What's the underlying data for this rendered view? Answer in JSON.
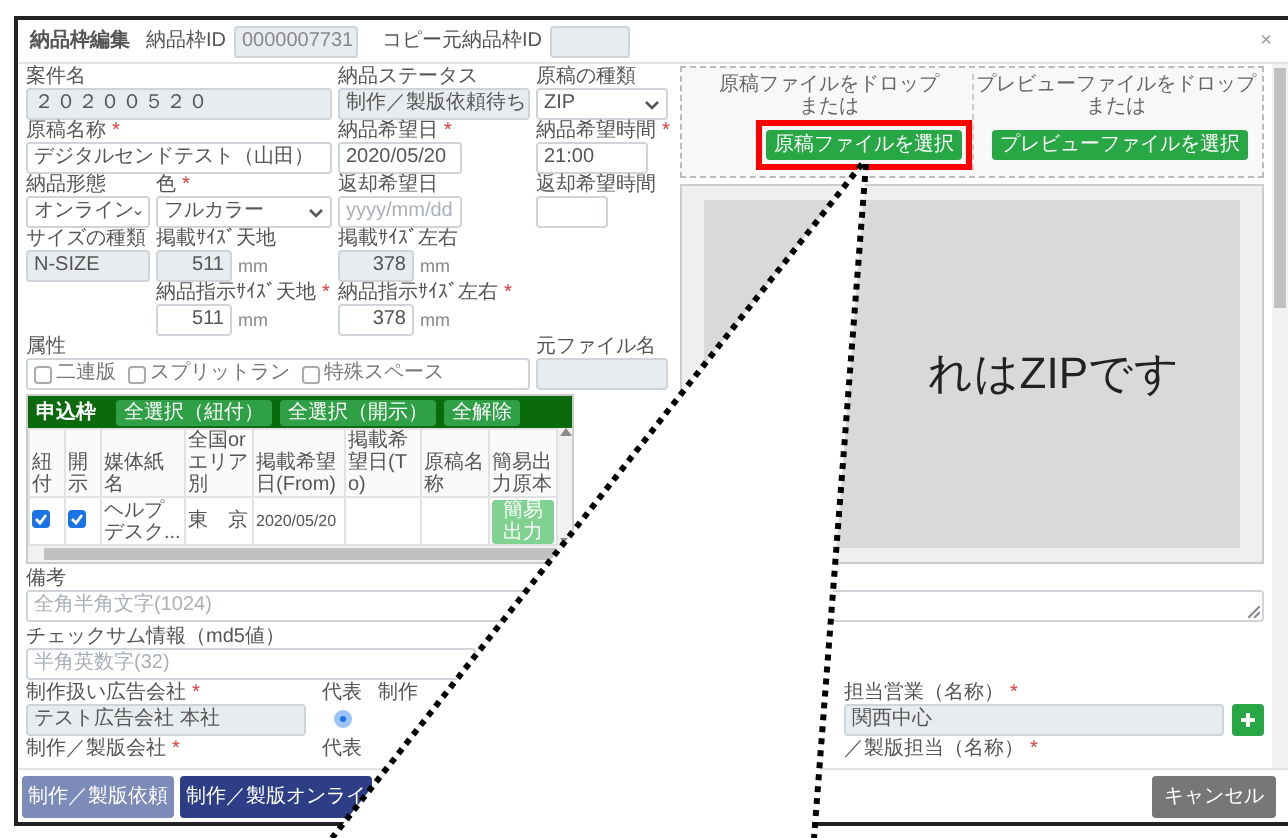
{
  "modal": {
    "title": "納品枠編集",
    "id_label": "納品枠ID",
    "id_value": "0000007731",
    "copy_label": "コピー元納品枠ID",
    "close": "×"
  },
  "form_rows": [
    [
      {
        "kind": "text",
        "label": "案件名",
        "value": "２０２００５２０",
        "readonly": true
      },
      {
        "kind": "text",
        "label": "納品ステータス",
        "value": "制作／製版依頼待ち",
        "readonly": true
      },
      {
        "kind": "select",
        "label": "原稿の種類",
        "value": "ZIP"
      }
    ],
    [
      {
        "kind": "text",
        "label": "原稿名称",
        "required_mark": "*",
        "value": "デジタルセンドテスト（山田）",
        "readonly": false
      },
      {
        "kind": "text",
        "label": "納品希望日",
        "required_mark": "*",
        "value": "2020/05/20",
        "readonly": false
      },
      {
        "kind": "text",
        "label": "納品希望時間",
        "required_mark": "*",
        "value": "21:00",
        "readonly": false
      }
    ],
    [
      {
        "kind": "select",
        "label": "納品形態",
        "value": "オンライン"
      },
      {
        "kind": "select",
        "label": "色",
        "required_mark": "*",
        "value": "フルカラー"
      },
      {
        "kind": "text",
        "label": "返却希望日",
        "placeholder": "yyyy/mm/dd",
        "readonly": false
      },
      {
        "kind": "text",
        "label": "返却希望時間",
        "readonly": false
      }
    ],
    [
      {
        "kind": "text",
        "label": "サイズの種類",
        "value": "N-SIZE",
        "readonly": true
      },
      {
        "kind": "unit",
        "label": "掲載ｻｲｽﾞ天地",
        "value": "511",
        "unit": "mm",
        "readonly": true
      },
      {
        "kind": "unit",
        "label": "掲載ｻｲｽﾞ左右",
        "value": "378",
        "unit": "mm",
        "readonly": true
      }
    ],
    [
      {
        "kind": "unit",
        "label": "納品指示ｻｲｽﾞ天地",
        "required_mark": "*",
        "value": "511",
        "unit": "mm",
        "readonly": false
      },
      {
        "kind": "unit",
        "label": "納品指示ｻｲｽﾞ左右",
        "required_mark": "*",
        "value": "378",
        "unit": "mm",
        "readonly": false
      }
    ],
    [
      {
        "kind": "checks",
        "label": "属性",
        "options": [
          {
            "label": "二連版",
            "checked": false
          },
          {
            "label": "スプリットラン",
            "checked": false
          },
          {
            "label": "特殊スペース",
            "checked": false
          }
        ]
      },
      {
        "kind": "text",
        "label": "元ファイル名",
        "readonly": true
      }
    ]
  ],
  "applications": {
    "title": "申込枠",
    "buttons": [
      "全選択（紐付）",
      "全選択（開示）",
      "全解除"
    ],
    "columns": [
      "紐付",
      "開示",
      "媒体紙名",
      "全国or エリア別",
      "掲載希望日(From)",
      "掲載希望日(To)",
      "原稿名称",
      "簡易出力原本"
    ],
    "rows": [
      {
        "cells": [
          {
            "kind": "check",
            "checked": true
          },
          {
            "kind": "check",
            "checked": true
          },
          {
            "kind": "text",
            "text": "ヘルプデスク..."
          },
          {
            "kind": "text",
            "text": "東　京"
          },
          {
            "kind": "date",
            "text": "2020/05/20"
          },
          {
            "kind": "empty"
          },
          {
            "kind": "empty"
          },
          {
            "kind": "button",
            "text": "簡易出力"
          }
        ]
      }
    ]
  },
  "uploads": [
    {
      "drop_text": "原稿ファイルをドロップ",
      "or_text": "または",
      "button": "原稿ファイルを選択",
      "highlighted": true
    },
    {
      "drop_text": "プレビューファイルをドロップ",
      "or_text": "または",
      "button": "プレビューファイルを選択",
      "highlighted": false
    }
  ],
  "preview": {
    "text": "れはZIPです"
  },
  "notes": {
    "label": "備考",
    "placeholder": "全角半角文字(1024)"
  },
  "checksum": {
    "label": "チェックサム情報（md5値）",
    "placeholder": "半角英数字(32)"
  },
  "agency": {
    "label": "制作扱い広告会社",
    "required_mark": "*",
    "value": "テスト広告会社 本社",
    "readonly": true,
    "rep_label": "代表",
    "rep_selected": true,
    "next_label": "制作"
  },
  "sales": {
    "label": "担当営業（名称）",
    "required_mark": "*",
    "value": "関西中心",
    "readonly": true
  },
  "producer": {
    "label": "制作／製版会社",
    "required_mark": "*",
    "rep_label": "代表"
  },
  "producer_staff": {
    "label": "／製版担当（名称）",
    "required_mark": "*"
  },
  "footer_buttons": [
    {
      "label": "制作／製版依頼",
      "kind": "secondary"
    },
    {
      "label": "制作／製版オンライ",
      "kind": "primary"
    },
    {
      "label": "キャンセル",
      "kind": "cancel"
    }
  ]
}
